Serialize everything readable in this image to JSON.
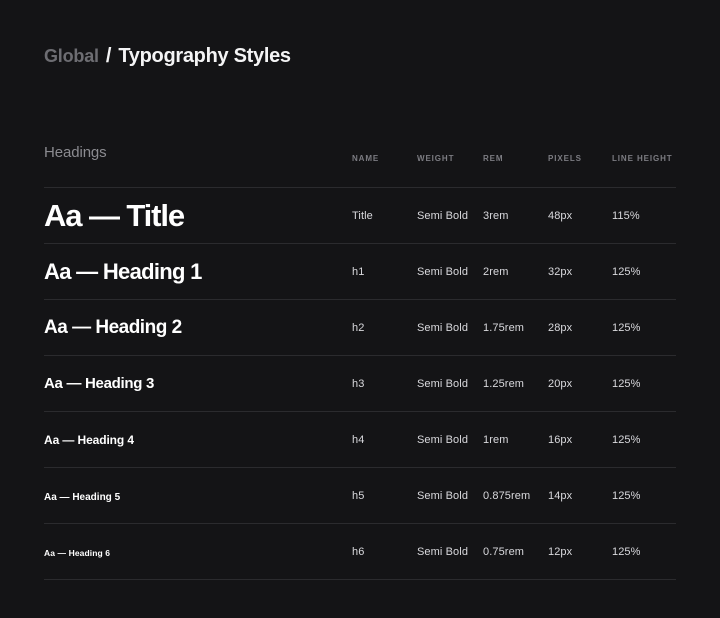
{
  "header": {
    "parent": "Global",
    "separator": "/",
    "title": "Typography Styles"
  },
  "table": {
    "section_label": "Headings",
    "columns": [
      "NAME",
      "WEIGHT",
      "REM",
      "PIXELS",
      "LINE HEIGHT"
    ],
    "rows": [
      {
        "sample": "Aa — Title",
        "name": "Title",
        "weight": "Semi Bold",
        "rem": "3rem",
        "pixels": "48px",
        "line_height": "115%"
      },
      {
        "sample": "Aa — Heading 1",
        "name": "h1",
        "weight": "Semi Bold",
        "rem": "2rem",
        "pixels": "32px",
        "line_height": "125%"
      },
      {
        "sample": "Aa — Heading 2",
        "name": "h2",
        "weight": "Semi Bold",
        "rem": "1.75rem",
        "pixels": "28px",
        "line_height": "125%"
      },
      {
        "sample": "Aa — Heading 3",
        "name": "h3",
        "weight": "Semi Bold",
        "rem": "1.25rem",
        "pixels": "20px",
        "line_height": "125%"
      },
      {
        "sample": "Aa — Heading 4",
        "name": "h4",
        "weight": "Semi Bold",
        "rem": "1rem",
        "pixels": "16px",
        "line_height": "125%"
      },
      {
        "sample": "Aa — Heading 5",
        "name": "h5",
        "weight": "Semi Bold",
        "rem": "0.875rem",
        "pixels": "14px",
        "line_height": "125%"
      },
      {
        "sample": "Aa — Heading 6",
        "name": "h6",
        "weight": "Semi Bold",
        "rem": "0.75rem",
        "pixels": "12px",
        "line_height": "125%"
      }
    ]
  },
  "colors": {
    "background": "#141416",
    "text_primary": "#ffffff",
    "text_secondary": "#8b8b90",
    "text_muted": "#6d6d72",
    "divider": "#2b2b2e"
  }
}
